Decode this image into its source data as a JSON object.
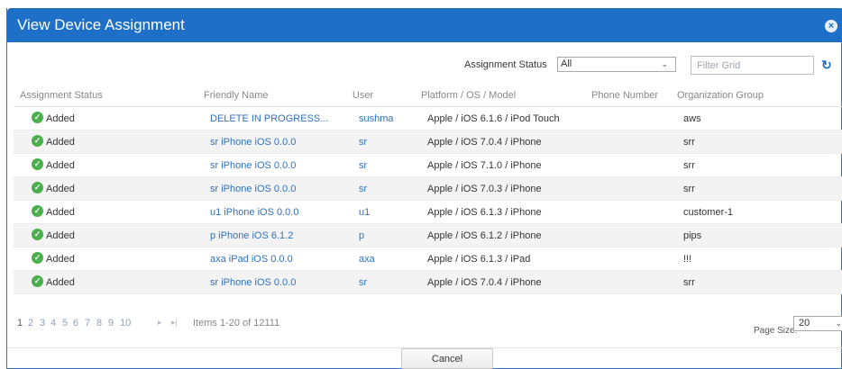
{
  "dialog": {
    "title": "View Device Assignment",
    "close_label": "×"
  },
  "toolbar": {
    "assignment_status_label": "Assignment Status",
    "assignment_status_value": "All",
    "filter_placeholder": "Filter Grid",
    "refresh_icon": "↻"
  },
  "grid": {
    "columns": [
      "Assignment Status",
      "Friendly Name",
      "User",
      "Platform / OS / Model",
      "Phone Number",
      "Organization Group"
    ],
    "rows": [
      {
        "status": "Added",
        "friendly": "DELETE IN PROGRESS...",
        "user": "sushma",
        "platform": "Apple / iOS 6.1.6 / iPod Touch",
        "phone": "",
        "org": "aws"
      },
      {
        "status": "Added",
        "friendly": "sr iPhone iOS 0.0.0",
        "user": "sr",
        "platform": "Apple / iOS 7.0.4 / iPhone",
        "phone": "",
        "org": "srr"
      },
      {
        "status": "Added",
        "friendly": "sr iPhone iOS 0.0.0",
        "user": "sr",
        "platform": "Apple / iOS 7.1.0 / iPhone",
        "phone": "",
        "org": "srr"
      },
      {
        "status": "Added",
        "friendly": "sr iPhone iOS 0.0.0",
        "user": "sr",
        "platform": "Apple / iOS 7.0.3 / iPhone",
        "phone": "",
        "org": "srr"
      },
      {
        "status": "Added",
        "friendly": "u1 iPhone iOS 0.0.0",
        "user": "u1",
        "platform": "Apple / iOS 6.1.3 / iPhone",
        "phone": "",
        "org": "customer-1"
      },
      {
        "status": "Added",
        "friendly": "p iPhone iOS 6.1.2",
        "user": "p",
        "platform": "Apple / iOS 6.1.2 / iPhone",
        "phone": "",
        "org": "pips"
      },
      {
        "status": "Added",
        "friendly": "axa iPad iOS 0.0.0",
        "user": "axa",
        "platform": "Apple / iOS 6.1.3 / iPad",
        "phone": "",
        "org": "!!!"
      },
      {
        "status": "Added",
        "friendly": "sr iPhone iOS 0.0.0",
        "user": "sr",
        "platform": "Apple / iOS 7.0.4 / iPhone",
        "phone": "",
        "org": "srr"
      }
    ]
  },
  "pager": {
    "pages": [
      "1",
      "2",
      "3",
      "4",
      "5",
      "6",
      "7",
      "8",
      "9",
      "10"
    ],
    "next_arrow": "▸",
    "last_arrow": "▸|",
    "items_text": "Items 1-20 of 12111",
    "page_size_label": "Page Size:",
    "page_size_value": "20"
  },
  "footer": {
    "cancel_label": "Cancel"
  },
  "colors": {
    "titlebar": "#1d6fc8",
    "link": "#2f72c2",
    "added_check": "#4cae4c"
  }
}
